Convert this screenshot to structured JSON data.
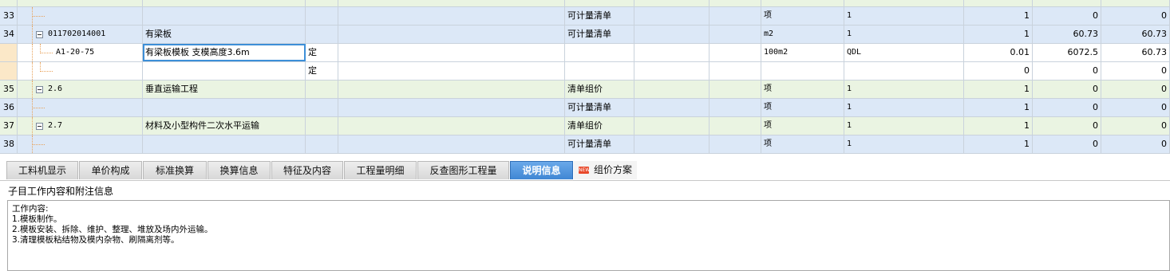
{
  "grid": {
    "rows": [
      {
        "num": "33",
        "code": "",
        "name": "",
        "unit_type": "",
        "desc": "",
        "type": "可计量清单",
        "unit": "项",
        "expr": "1",
        "qty": "1",
        "price": "0",
        "total": "0",
        "style": "blue",
        "tree": "leaf"
      },
      {
        "num": "34",
        "code": "011702014001",
        "name": "有梁板",
        "unit_type": "",
        "desc": "",
        "type": "可计量清单",
        "unit": "m2",
        "expr": "1",
        "qty": "1",
        "price": "60.73",
        "total": "60.73",
        "style": "blue",
        "tree": "node"
      },
      {
        "num": "",
        "code": "A1-20-75",
        "name": "有梁板模板 支模高度3.6m",
        "unit_type": "定",
        "desc": "",
        "type": "",
        "unit": "100m2",
        "expr": "QDL",
        "qty": "0.01",
        "price": "6072.5",
        "total": "60.73",
        "style": "white",
        "tree": "child",
        "selected": true
      },
      {
        "num": "",
        "code": "",
        "name": "",
        "unit_type": "定",
        "desc": "",
        "type": "",
        "unit": "",
        "expr": "",
        "qty": "0",
        "price": "0",
        "total": "0",
        "style": "white",
        "tree": "child"
      },
      {
        "num": "35",
        "code": "2.6",
        "name": "垂直运输工程",
        "unit_type": "",
        "desc": "",
        "type": "清单组价",
        "unit": "项",
        "expr": "1",
        "qty": "1",
        "price": "0",
        "total": "0",
        "style": "green",
        "tree": "node"
      },
      {
        "num": "36",
        "code": "",
        "name": "",
        "unit_type": "",
        "desc": "",
        "type": "可计量清单",
        "unit": "项",
        "expr": "1",
        "qty": "1",
        "price": "0",
        "total": "0",
        "style": "blue",
        "tree": "leaf"
      },
      {
        "num": "37",
        "code": "2.7",
        "name": "材料及小型构件二次水平运输",
        "unit_type": "",
        "desc": "",
        "type": "清单组价",
        "unit": "项",
        "expr": "1",
        "qty": "1",
        "price": "0",
        "total": "0",
        "style": "green",
        "tree": "node"
      },
      {
        "num": "38",
        "code": "",
        "name": "",
        "unit_type": "",
        "desc": "",
        "type": "可计量清单",
        "unit": "项",
        "expr": "1",
        "qty": "1",
        "price": "0",
        "total": "0",
        "style": "blue",
        "tree": "leaf"
      }
    ]
  },
  "tabs": [
    {
      "label": "工料机显示",
      "active": false
    },
    {
      "label": "单价构成",
      "active": false
    },
    {
      "label": "标准换算",
      "active": false
    },
    {
      "label": "换算信息",
      "active": false
    },
    {
      "label": "特征及内容",
      "active": false
    },
    {
      "label": "工程量明细",
      "active": false
    },
    {
      "label": "反查图形工程量",
      "active": false
    },
    {
      "label": "说明信息",
      "active": true
    },
    {
      "label": "组价方案",
      "active": false,
      "badge": "NEW"
    }
  ],
  "panel": {
    "subtitle": "子目工作内容和附注信息",
    "lines": [
      "工作内容:",
      "1.模板制作。",
      "2.模板安装、拆除、维护、整理、堆放及场内外运输。",
      "3.清理模板粘结物及模内杂物、刷隔离剂等。"
    ]
  },
  "colors": {
    "row_blue": "#dce8f7",
    "row_green": "#eaf4e2",
    "tab_active": "#3f86d4"
  }
}
